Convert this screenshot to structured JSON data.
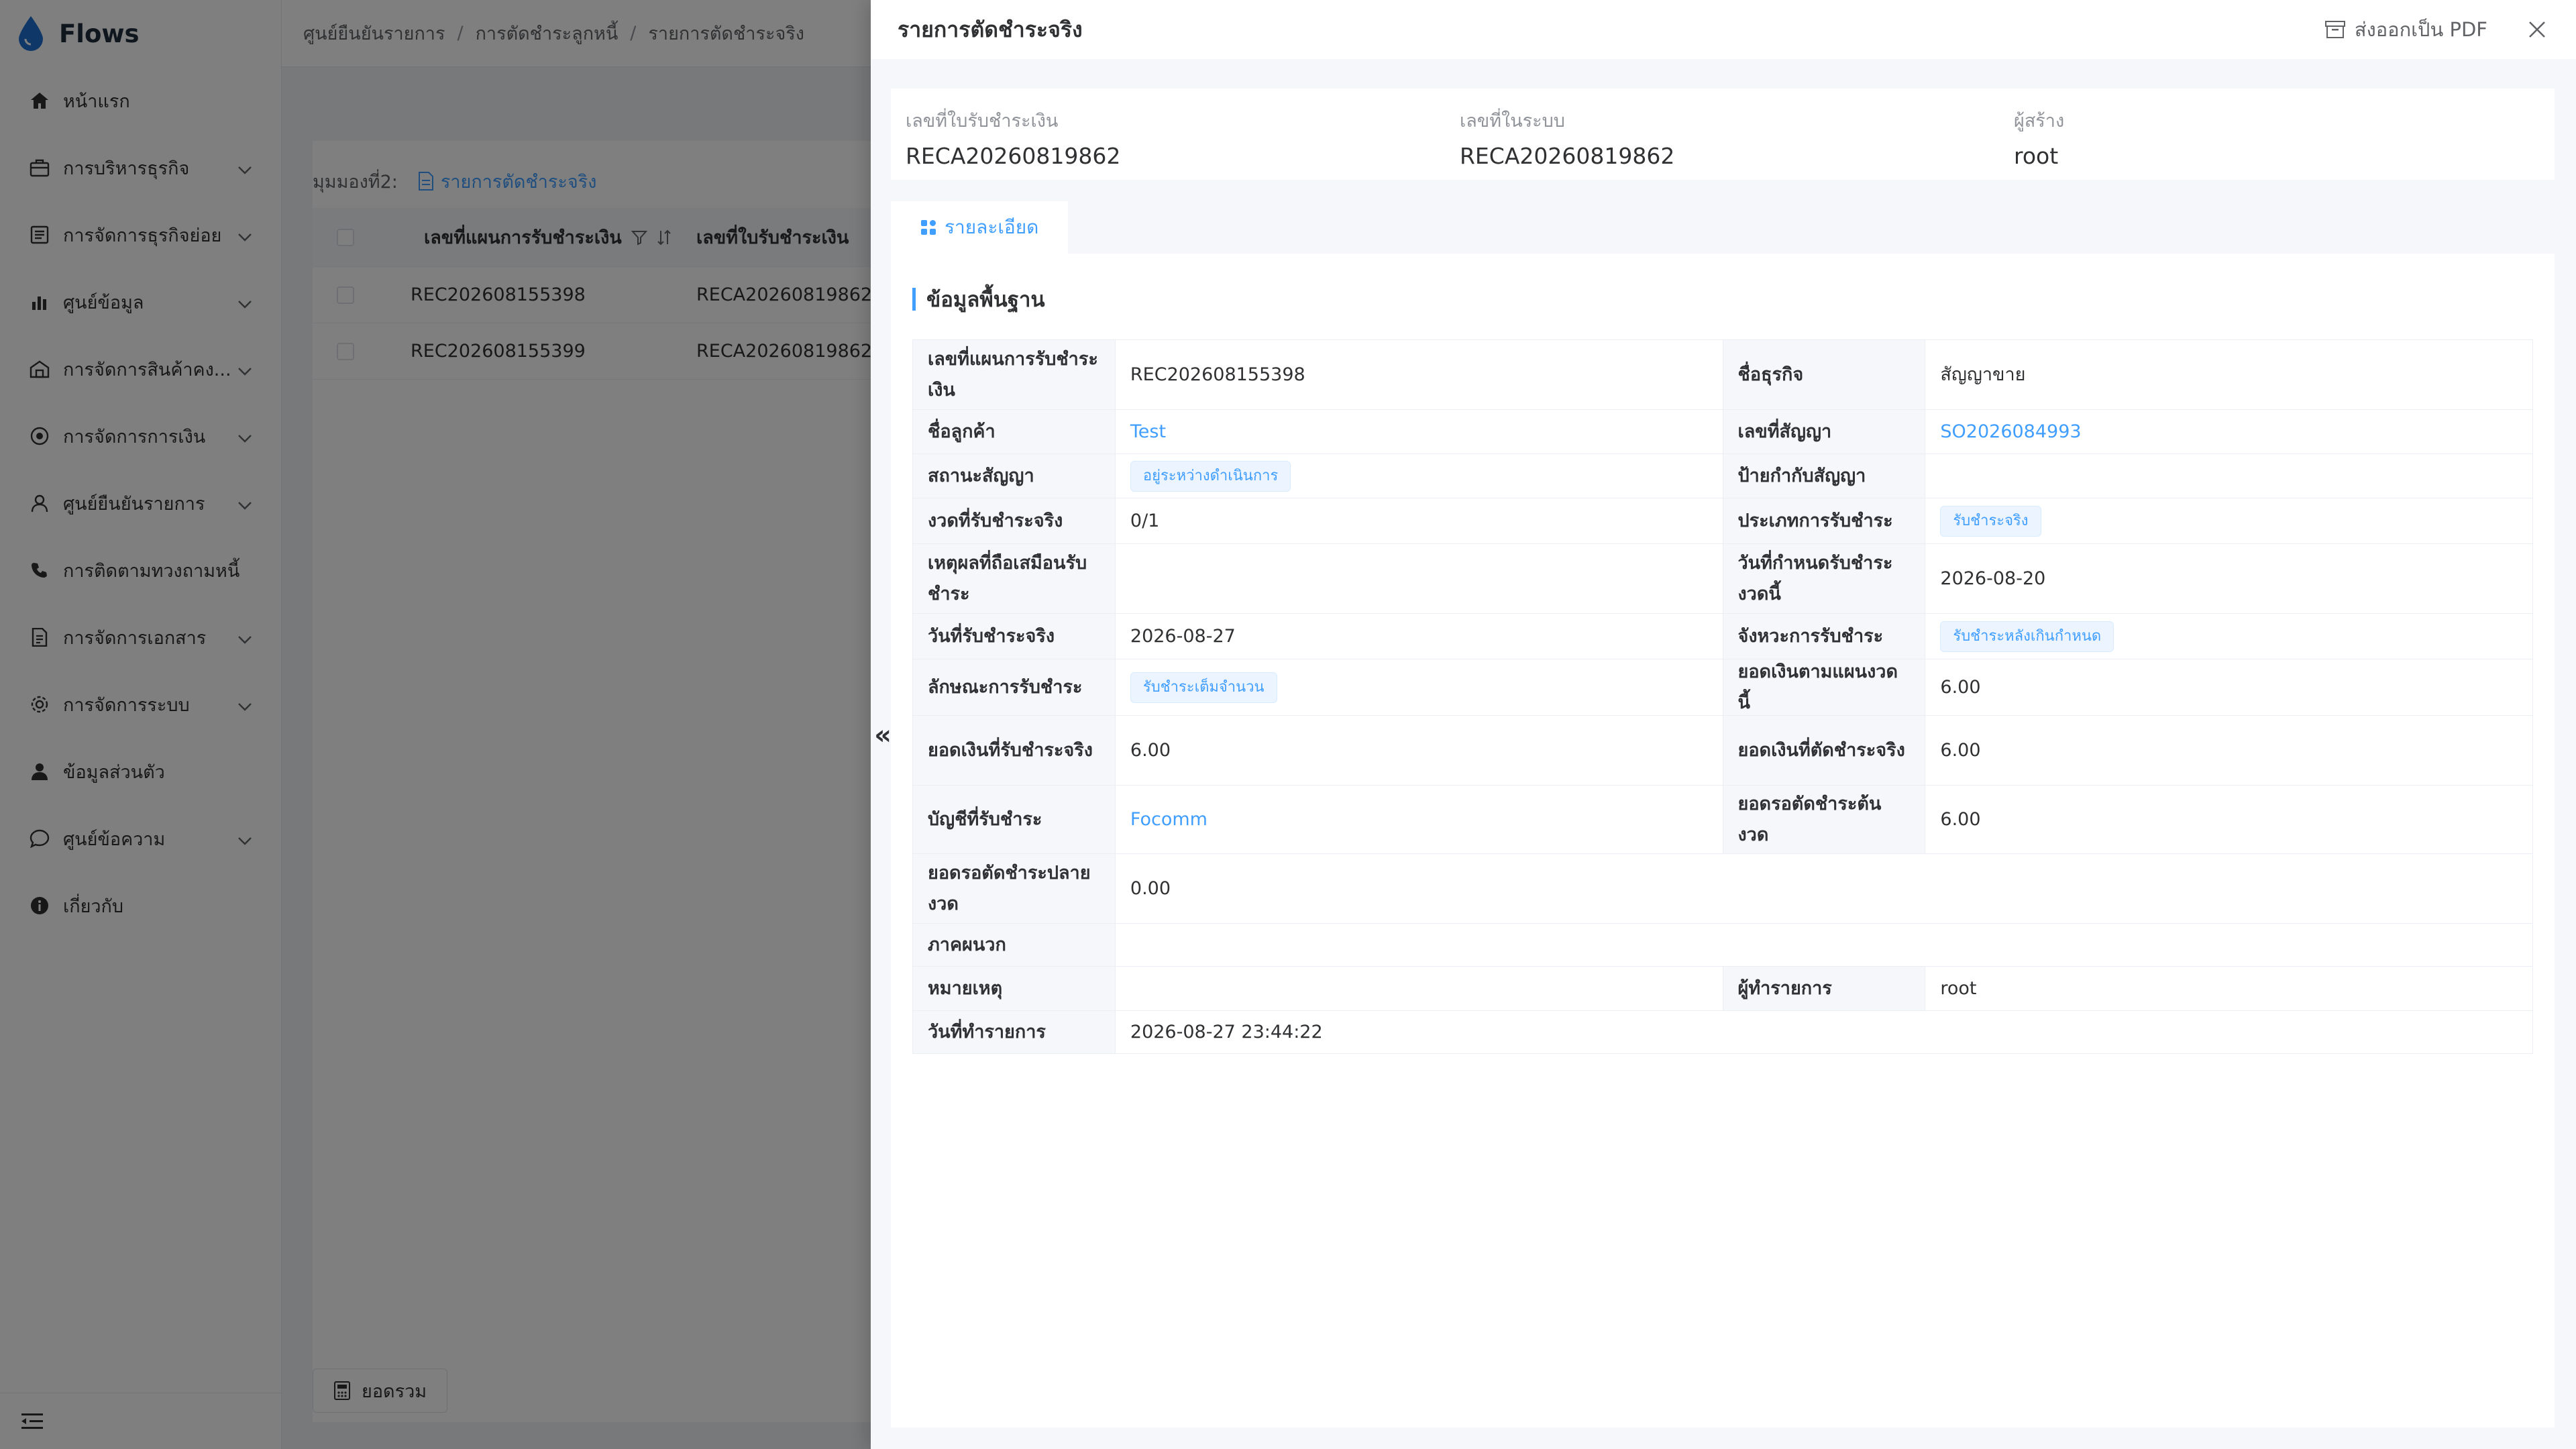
{
  "app": {
    "name": "Flows"
  },
  "sidebar": {
    "items": [
      {
        "label": "หน้าแรก",
        "icon": "home-icon",
        "chevron": false
      },
      {
        "label": "การบริหารธุรกิจ",
        "icon": "briefcase-icon",
        "chevron": true
      },
      {
        "label": "การจัดการธุรกิจย่อย",
        "icon": "list-icon",
        "chevron": true
      },
      {
        "label": "ศูนย์ข้อมูล",
        "icon": "bar-chart-icon",
        "chevron": true
      },
      {
        "label": "การจัดการสินค้าคง...",
        "icon": "warehouse-icon",
        "chevron": true
      },
      {
        "label": "การจัดการการเงิน",
        "icon": "coin-icon",
        "chevron": true
      },
      {
        "label": "ศูนย์ยืนยันรายการ",
        "icon": "user-check-icon",
        "chevron": true
      },
      {
        "label": "การติดตามทวงถามหนี้",
        "icon": "phone-icon",
        "chevron": false
      },
      {
        "label": "การจัดการเอกสาร",
        "icon": "document-icon",
        "chevron": true
      },
      {
        "label": "การจัดการระบบ",
        "icon": "gear-icon",
        "chevron": true
      },
      {
        "label": "ข้อมูลส่วนตัว",
        "icon": "user-icon",
        "chevron": false
      },
      {
        "label": "ศูนย์ข้อความ",
        "icon": "message-icon",
        "chevron": true
      },
      {
        "label": "เกี่ยวกับ",
        "icon": "info-icon",
        "chevron": false
      }
    ]
  },
  "breadcrumb": [
    "ศูนย์ยืนยันรายการ",
    "การตัดชำระลูกหนี้",
    "รายการตัดชำระจริง"
  ],
  "view": {
    "label": "มุมมองที่2:",
    "link": "รายการตัดชำระจริง"
  },
  "table": {
    "headers": [
      "เลขที่แผนการรับชำระเงิน",
      "เลขที่ใบรับชำระเงิน"
    ],
    "rows": [
      [
        "REC202608155398",
        "RECA20260819862"
      ],
      [
        "REC202608155399",
        "RECA20260819862"
      ]
    ]
  },
  "summary_button": "ยอดรวม",
  "drawer": {
    "title": "รายการตัดชำระจริง",
    "export_pdf": "ส่งออกเป็น PDF",
    "meta": [
      {
        "label": "เลขที่ใบรับชำระเงิน",
        "value": "RECA20260819862"
      },
      {
        "label": "เลขที่ในระบบ",
        "value": "RECA20260819862"
      },
      {
        "label": "ผู้สร้าง",
        "value": "root"
      }
    ],
    "tab": "รายละเอียด",
    "section_title": "ข้อมูลพื้นฐาน",
    "rows": [
      [
        {
          "label": "เลขที่แผนการรับชำระเงิน",
          "value": "REC202608155398",
          "type": "text"
        },
        {
          "label": "ชื่อธุรกิจ",
          "value": "สัญญาขาย",
          "type": "text"
        }
      ],
      [
        {
          "label": "ชื่อลูกค้า",
          "value": "Test",
          "type": "link"
        },
        {
          "label": "เลขที่สัญญา",
          "value": "SO2026084993",
          "type": "link"
        }
      ],
      [
        {
          "label": "สถานะสัญญา",
          "value": "อยู่ระหว่างดำเนินการ",
          "type": "tag"
        },
        {
          "label": "ป้ายกำกับสัญญา",
          "value": "",
          "type": "text"
        }
      ],
      [
        {
          "label": "งวดที่รับชำระจริง",
          "value": "0/1",
          "type": "text"
        },
        {
          "label": "ประเภทการรับชำระ",
          "value": "รับชำระจริง",
          "type": "tag"
        }
      ],
      [
        {
          "label": "เหตุผลที่ถือเสมือนรับชำระ",
          "value": "",
          "type": "text"
        },
        {
          "label": "วันที่กำหนดรับชำระงวดนี้",
          "value": "2026-08-20",
          "type": "text"
        }
      ],
      [
        {
          "label": "วันที่รับชำระจริง",
          "value": "2026-08-27",
          "type": "text"
        },
        {
          "label": "จังหวะการรับชำระ",
          "value": "รับชำระหลังเกินกำหนด",
          "type": "tag"
        }
      ],
      [
        {
          "label": "ลักษณะการรับชำระ",
          "value": "รับชำระเต็มจำนวน",
          "type": "tag"
        },
        {
          "label": "ยอดเงินตามแผนงวดนี้",
          "value": "6.00",
          "type": "text"
        }
      ],
      [
        {
          "label": "ยอดเงินที่รับชำระจริง",
          "value": "6.00",
          "type": "text"
        },
        {
          "label": "ยอดเงินที่ตัดชำระจริง",
          "value": "6.00",
          "type": "text"
        }
      ],
      [
        {
          "label": "บัญชีที่รับชำระ",
          "value": "Focomm",
          "type": "link"
        },
        {
          "label": "ยอดรอตัดชำระต้นงวด",
          "value": "6.00",
          "type": "text"
        }
      ],
      [
        {
          "label": "ยอดรอตัดชำระปลายงวด",
          "value": "0.00",
          "type": "text"
        }
      ],
      [
        {
          "label": "ภาคผนวก",
          "value": "",
          "type": "text"
        }
      ],
      [
        {
          "label": "หมายเหตุ",
          "value": "",
          "type": "text"
        },
        {
          "label": "ผู้ทำรายการ",
          "value": "root",
          "type": "text"
        }
      ],
      [
        {
          "label": "วันที่ทำรายการ",
          "value": "2026-08-27 23:44:22",
          "type": "text"
        }
      ]
    ]
  },
  "colors": {
    "accent": "#409eff",
    "text": "#303133",
    "label_bg": "#f5f7fa",
    "overlay": "rgba(0,0,0,0.5)"
  }
}
